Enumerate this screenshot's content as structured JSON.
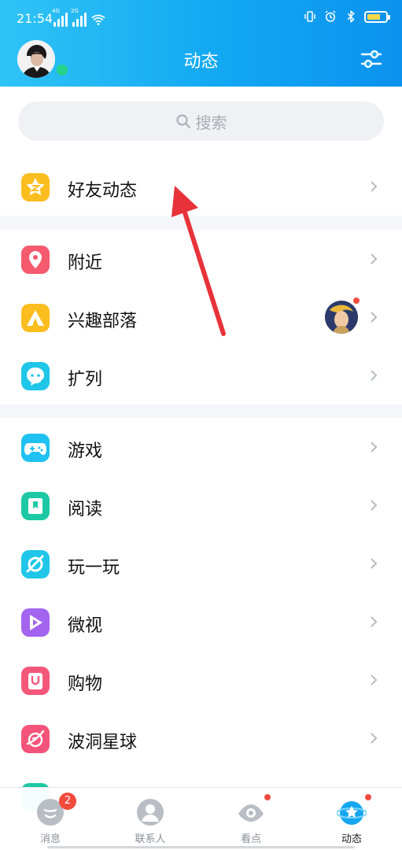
{
  "status_bar": {
    "time": "21:54",
    "sim1": "4G",
    "sim2": "2G",
    "battery_color": "#ffd84a"
  },
  "header": {
    "title": "动态",
    "settings_icon": "sliders-icon"
  },
  "search": {
    "placeholder": "搜索"
  },
  "sections": [
    {
      "items": [
        {
          "label": "好友动态",
          "icon": "star-icon",
          "color": "#fcbd1e"
        }
      ]
    },
    {
      "items": [
        {
          "label": "附近",
          "icon": "location-pin-icon",
          "color": "#f55a6e"
        },
        {
          "label": "兴趣部落",
          "icon": "tent-icon",
          "color": "#fcbd1e",
          "has_notification": true
        },
        {
          "label": "扩列",
          "icon": "chat-bubble-icon",
          "color": "#1fc6e8"
        }
      ]
    },
    {
      "items": [
        {
          "label": "游戏",
          "icon": "gamepad-icon",
          "color": "#20c1f2"
        },
        {
          "label": "阅读",
          "icon": "book-icon",
          "color": "#1dc9a4"
        },
        {
          "label": "玩一玩",
          "icon": "planet-icon",
          "color": "#1fc6e8"
        },
        {
          "label": "微视",
          "icon": "play-icon",
          "color": "#a364f0"
        },
        {
          "label": "购物",
          "icon": "shopping-bag-icon",
          "color": "#f4577a"
        },
        {
          "label": "波洞星球",
          "icon": "wave-planet-icon",
          "color": "#f5547a"
        }
      ]
    }
  ],
  "tab_bar": {
    "tabs": [
      {
        "label": "消息",
        "badge": "2"
      },
      {
        "label": "联系人"
      },
      {
        "label": "看点"
      },
      {
        "label": "动态"
      }
    ],
    "active_color": "#14a7f0"
  }
}
